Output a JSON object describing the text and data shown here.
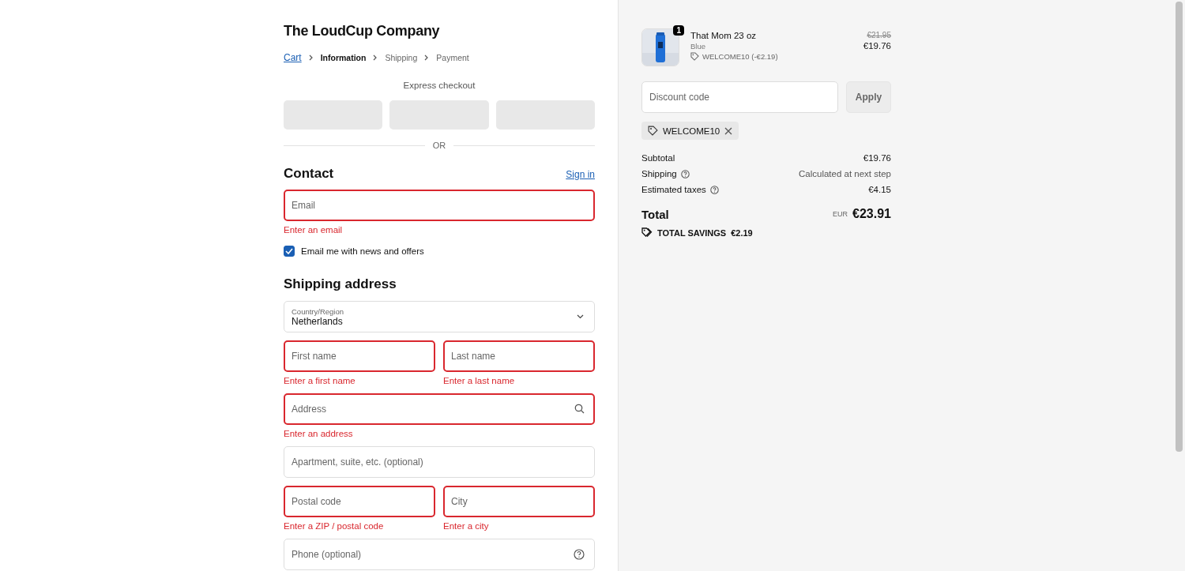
{
  "store_name": "The LoudCup Company",
  "breadcrumb": [
    {
      "label": "Cart",
      "kind": "link"
    },
    {
      "label": "Information",
      "kind": "current"
    },
    {
      "label": "Shipping",
      "kind": "upcoming"
    },
    {
      "label": "Payment",
      "kind": "upcoming"
    }
  ],
  "express_checkout": {
    "title": "Express checkout",
    "divider": "OR"
  },
  "contact": {
    "title": "Contact",
    "sign_in": "Sign in",
    "email": {
      "placeholder": "Email",
      "invalid": true,
      "error": "Enter an email"
    },
    "newsletter": {
      "label": "Email me with news and offers",
      "checked": true
    }
  },
  "shipping_address": {
    "title": "Shipping address",
    "country": {
      "label": "Country/Region",
      "value": "Netherlands"
    },
    "rows": [
      [
        {
          "placeholder": "First name",
          "invalid": true,
          "error": "Enter a first name"
        },
        {
          "placeholder": "Last name",
          "invalid": true,
          "error": "Enter a last name"
        }
      ],
      [
        {
          "placeholder": "Address",
          "invalid": true,
          "error": "Enter an address"
        }
      ],
      [
        {
          "placeholder": "Apartment, suite, etc. (optional)",
          "invalid": false
        }
      ],
      [
        {
          "placeholder": "Postal code",
          "invalid": true,
          "error": "Enter a ZIP / postal code"
        },
        {
          "placeholder": "City",
          "invalid": true,
          "error": "Enter a city"
        }
      ],
      [
        {
          "placeholder": "Phone (optional)",
          "invalid": false
        }
      ]
    ]
  },
  "order": {
    "item": {
      "quantity": "1",
      "name": "That Mom 23 oz",
      "variant": "Blue",
      "discount": "WELCOME10 (-€2.19)",
      "original_price": "€21.95",
      "price": "€19.76"
    },
    "discount_field": {
      "placeholder": "Discount code",
      "button": "Apply"
    },
    "applied_code": "WELCOME10",
    "lines": [
      {
        "label": "Subtotal",
        "value": "€19.76",
        "help": false
      },
      {
        "label": "Shipping",
        "value": "Calculated at next step",
        "help": true
      },
      {
        "label": "Estimated taxes",
        "value": "€4.15",
        "help": true
      }
    ],
    "total": {
      "label": "Total",
      "currency": "EUR",
      "amount": "€23.91"
    },
    "savings": {
      "label": "TOTAL SAVINGS",
      "amount": "€2.19"
    }
  }
}
